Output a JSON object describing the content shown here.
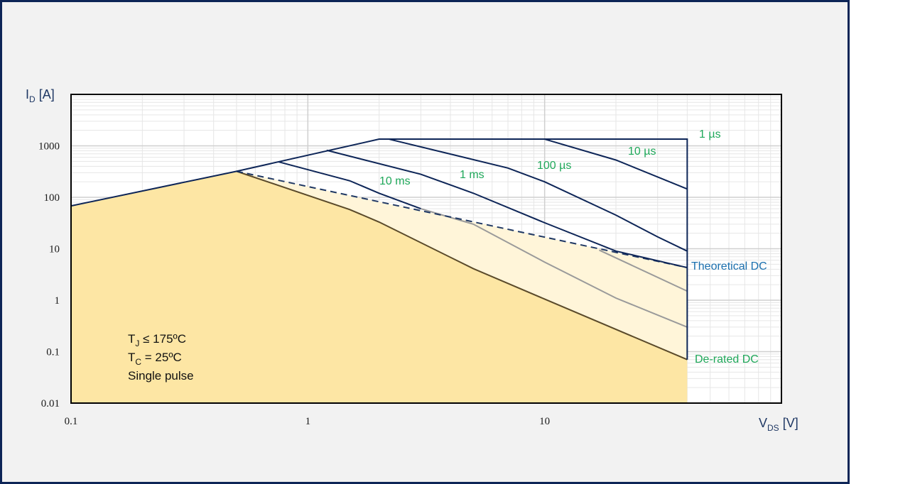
{
  "chart_data": {
    "type": "line",
    "xscale": "log",
    "yscale": "log",
    "xlim": [
      0.1,
      100
    ],
    "ylim": [
      0.01,
      10000
    ],
    "grid": true,
    "x_ticks": [
      "0.1",
      "1",
      "10"
    ],
    "y_ticks": [
      "0.01",
      "0.1",
      "1",
      "10",
      "100",
      "1000"
    ],
    "ylabel_main": "I",
    "ylabel_sub": "D",
    "ylabel_unit": " [A]",
    "xlabel_main": "V",
    "xlabel_sub": "DS",
    "xlabel_unit": " [V]",
    "conditions": {
      "line1_main": "T",
      "line1_sub": "J",
      "line1_rest": " ≤ 175ºC",
      "line2_main": "T",
      "line2_sub": "C",
      "line2_rest": " = 25ºC",
      "line3": "Single pulse"
    },
    "series": [
      {
        "name": "1 µs",
        "x": [
          0.1,
          0.5,
          2.0,
          40,
          40
        ],
        "y": [
          68,
          320,
          1350,
          1350,
          0.07
        ]
      },
      {
        "name": "10 µs",
        "x": [
          10,
          20,
          40
        ],
        "y": [
          1350,
          530,
          145
        ]
      },
      {
        "name": "100 µs",
        "x": [
          2.2,
          7,
          10,
          20,
          30,
          40
        ],
        "y": [
          1350,
          370,
          200,
          45,
          17,
          9
        ]
      },
      {
        "name": "1 ms",
        "x": [
          1.2,
          3,
          5,
          10,
          20,
          40
        ],
        "y": [
          820,
          280,
          120,
          32,
          9,
          4.3
        ]
      },
      {
        "name": "10 ms",
        "x": [
          0.75,
          1.5,
          2,
          3,
          5,
          10,
          20,
          40
        ],
        "y": [
          490,
          210,
          120,
          60,
          30,
          5.5,
          1.1,
          0.3
        ]
      },
      {
        "name": "Theoretical DC",
        "x": [
          0.5,
          40
        ],
        "y": [
          320,
          4.3
        ]
      },
      {
        "name": "De-rated DC",
        "x": [
          0.5,
          1.5,
          2,
          5,
          10,
          40
        ],
        "y": [
          320,
          58,
          33,
          4.1,
          1.05,
          0.07
        ]
      }
    ],
    "colors": {
      "curve": "#0d2557",
      "dashed": "#1f3864",
      "grey_curve": "#9a9a9a",
      "fill_dark": "#fde6a4",
      "fill_light": "#fff5d9",
      "label_green": "#1fa85a",
      "label_blue": "#1a6fae"
    }
  }
}
